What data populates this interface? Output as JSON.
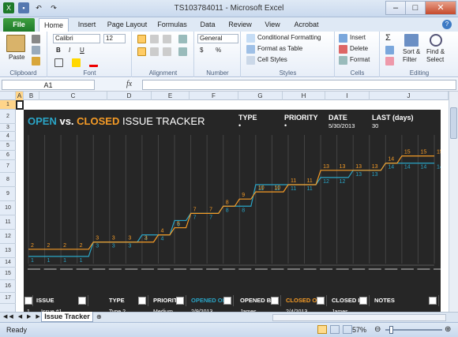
{
  "window": {
    "title": "TS103784011 - Microsoft Excel"
  },
  "tabs": [
    "File",
    "Home",
    "Insert",
    "Page Layout",
    "Formulas",
    "Data",
    "Review",
    "View",
    "Acrobat"
  ],
  "ribbon": {
    "clipboard": {
      "paste": "Paste",
      "label": "Clipboard"
    },
    "font": {
      "name": "Calibri",
      "size": "12",
      "label": "Font"
    },
    "alignment": {
      "label": "Alignment"
    },
    "number": {
      "format": "General",
      "label": "Number",
      "currency": "$",
      "percent": "%"
    },
    "styles": {
      "conditional": "Conditional Formatting",
      "format_table": "Format as Table",
      "cell_styles": "Cell Styles",
      "label": "Styles"
    },
    "cells": {
      "insert": "Insert",
      "delete": "Delete",
      "format": "Format",
      "label": "Cells"
    },
    "editing": {
      "sort": "Sort &",
      "filter": "Filter",
      "find": "Find &",
      "select": "Select",
      "label": "Editing"
    }
  },
  "formula_bar": {
    "name_box": "A1",
    "fx": "fx",
    "value": ""
  },
  "columns": [
    "A",
    "B",
    "C",
    "D",
    "E",
    "F",
    "G",
    "H",
    "I",
    "J"
  ],
  "rows": [
    "1",
    "2",
    "3",
    "4",
    "5",
    "6",
    "7",
    "8",
    "9",
    "10",
    "11",
    "12",
    "13",
    "14",
    "15",
    "16",
    "17"
  ],
  "tracker": {
    "title_open": "OPEN",
    "title_vs": "vs.",
    "title_closed": "CLOSED",
    "title_rest": "ISSUE TRACKER",
    "type_label": "TYPE",
    "priority_label": "PRIORITY",
    "date_label": "DATE",
    "date_value": "5/30/2013",
    "last_label": "LAST (days)",
    "last_value": "30"
  },
  "chart_data": {
    "type": "line",
    "series": [
      {
        "values": [
          1,
          1,
          1,
          1,
          3,
          3,
          3,
          4,
          4,
          6,
          7,
          7,
          8,
          8,
          11,
          11,
          11,
          11,
          12,
          12,
          13,
          13,
          14,
          14,
          14,
          14
        ]
      },
      {
        "values": [
          2,
          2,
          2,
          2,
          3,
          3,
          3,
          3,
          4,
          5,
          7,
          7,
          8,
          9,
          10,
          10,
          11,
          11,
          13,
          13,
          13,
          13,
          14,
          15,
          15,
          15
        ]
      }
    ],
    "colors": {
      "open": "#2aa5c7",
      "closed": "#f59b26"
    }
  },
  "table": {
    "headers": [
      "ISSUE",
      "TYPE",
      "PRIORITY",
      "OPENED ON",
      "OPENED BY",
      "CLOSED ON",
      "CLOSED BY",
      "NOTES"
    ],
    "row": [
      "1",
      "Issue #1",
      "Type 2",
      "Medium",
      "2/9/2013",
      "James",
      "2/4/2013",
      "James"
    ]
  },
  "sheet_tab": "Issue Tracker",
  "status": {
    "ready": "Ready",
    "zoom": "57%"
  }
}
